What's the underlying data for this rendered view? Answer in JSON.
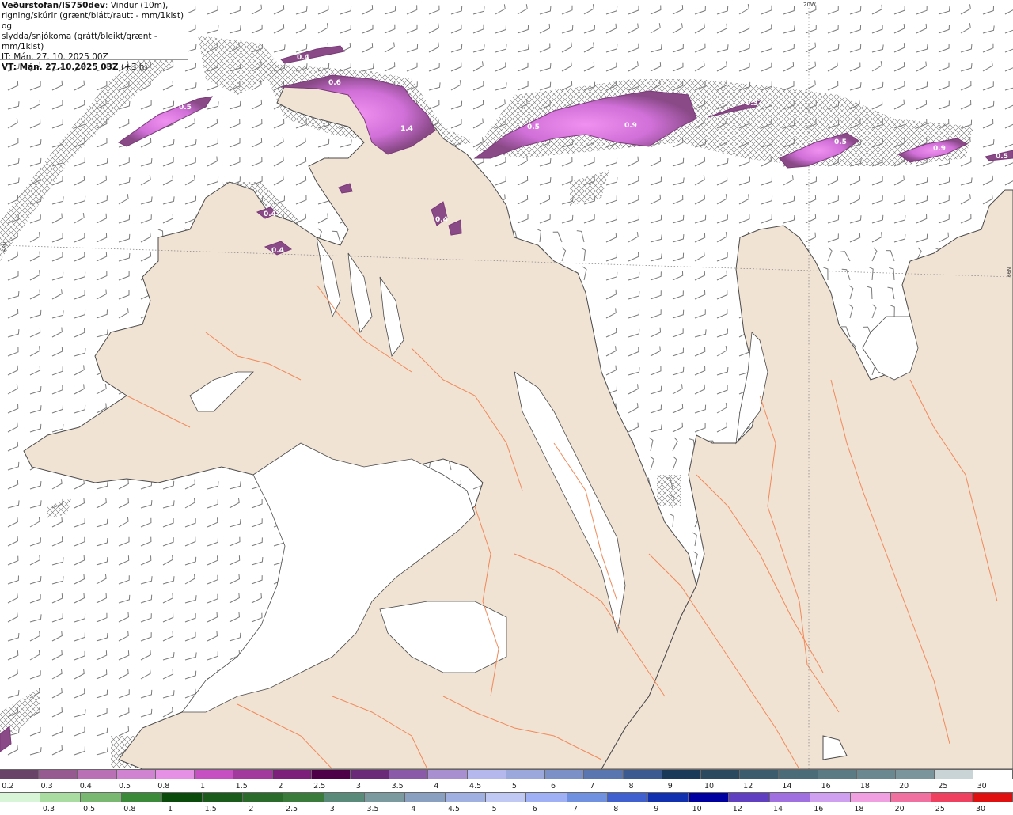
{
  "header": {
    "title": "Veðurstofan/IS750dev",
    "desc_1": ": Vindur (10m),",
    "desc_2": "rigning/skúrir (grænt/blátt/rautt - mm/1klst) og",
    "desc_3": "slydda/snjókoma (grátt/bleikt/grænt - mm/1klst)",
    "it_line": "IT: Mán. 27. 10. 2025 00Z",
    "vt_bold": "VT: Mán. 27.10.2025 03Z",
    "vt_rest": " (+3 h)"
  },
  "map": {
    "grid_labels": {
      "lon": "20W",
      "lat_left": "66N",
      "lat_right": "66N"
    },
    "colors": {
      "sea": "#ffffff",
      "land": "#f1e3d4",
      "coast": "#4a4a4a",
      "rivers": "#f08a5a",
      "barbs": "#666666"
    },
    "precip_labels": [
      "0.4",
      "0.6",
      "0.5",
      "1.4",
      "0.5",
      "0.9",
      "0.3",
      "0.5",
      "0.9",
      "0.5",
      "0.4",
      "0.4",
      "0.4"
    ]
  },
  "legend": {
    "top": {
      "labels": [
        "0.2",
        "0.3",
        "0.4",
        "0.5",
        "0.8",
        "1",
        "1.5",
        "2",
        "2.5",
        "3",
        "3.5",
        "4",
        "4.5",
        "5",
        "6",
        "7",
        "8",
        "9",
        "10",
        "12",
        "14",
        "16",
        "18",
        "20",
        "25",
        "30"
      ],
      "colors": [
        "#6a4468",
        "#965a90",
        "#b970b5",
        "#d083d0",
        "#e58fe5",
        "#c64fc2",
        "#a23a9e",
        "#7c1f7a",
        "#4d0048",
        "#6a2a78",
        "#8a5aa8",
        "#a890d0",
        "#b4b8ec",
        "#9aa8dc",
        "#7c90c8",
        "#5a76b0",
        "#3a5a90",
        "#1a3a5a",
        "#2a4a60",
        "#3a5c6c",
        "#4a6c78",
        "#5a7a84",
        "#6a8890",
        "#7a969c",
        "#c8d4d6",
        "#ffffff"
      ]
    },
    "bottom": {
      "labels": [
        "0.3",
        "0.5",
        "0.8",
        "1",
        "1.5",
        "2",
        "2.5",
        "3",
        "3.5",
        "4",
        "4.5",
        "5",
        "6",
        "7",
        "8",
        "9",
        "10",
        "12",
        "14",
        "16",
        "18",
        "20",
        "25",
        "30"
      ],
      "colors": [
        "#d8f5d8",
        "#a8dca0",
        "#78b870",
        "#3a8a3a",
        "#0a4a0a",
        "#1a5a1a",
        "#2a6a2a",
        "#3a7a3a",
        "#5a8a7a",
        "#7a9aa0",
        "#8aa0c0",
        "#a0b0e0",
        "#c0c8f4",
        "#a0b0f4",
        "#7090e0",
        "#4060d0",
        "#1030b0",
        "#0000a0",
        "#6040c0",
        "#a070e0",
        "#d0a0f0",
        "#f0a0e0",
        "#f070a0",
        "#f04060",
        "#e01010"
      ]
    }
  }
}
